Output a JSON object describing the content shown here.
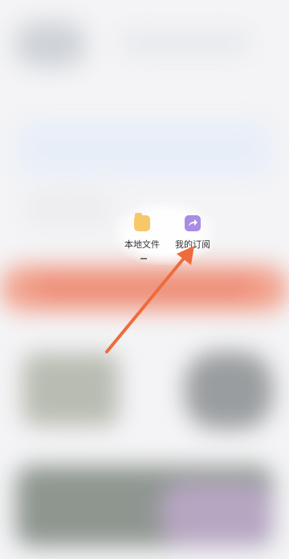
{
  "menu": {
    "items": [
      {
        "label": "本地文件",
        "icon": "folder-icon",
        "icon_color": "#f6c86a"
      },
      {
        "label": "我的订阅",
        "icon": "subscription-share-icon",
        "icon_color": "#a98ce6"
      }
    ]
  },
  "annotation": {
    "arrow_color": "#ef6b3c"
  }
}
